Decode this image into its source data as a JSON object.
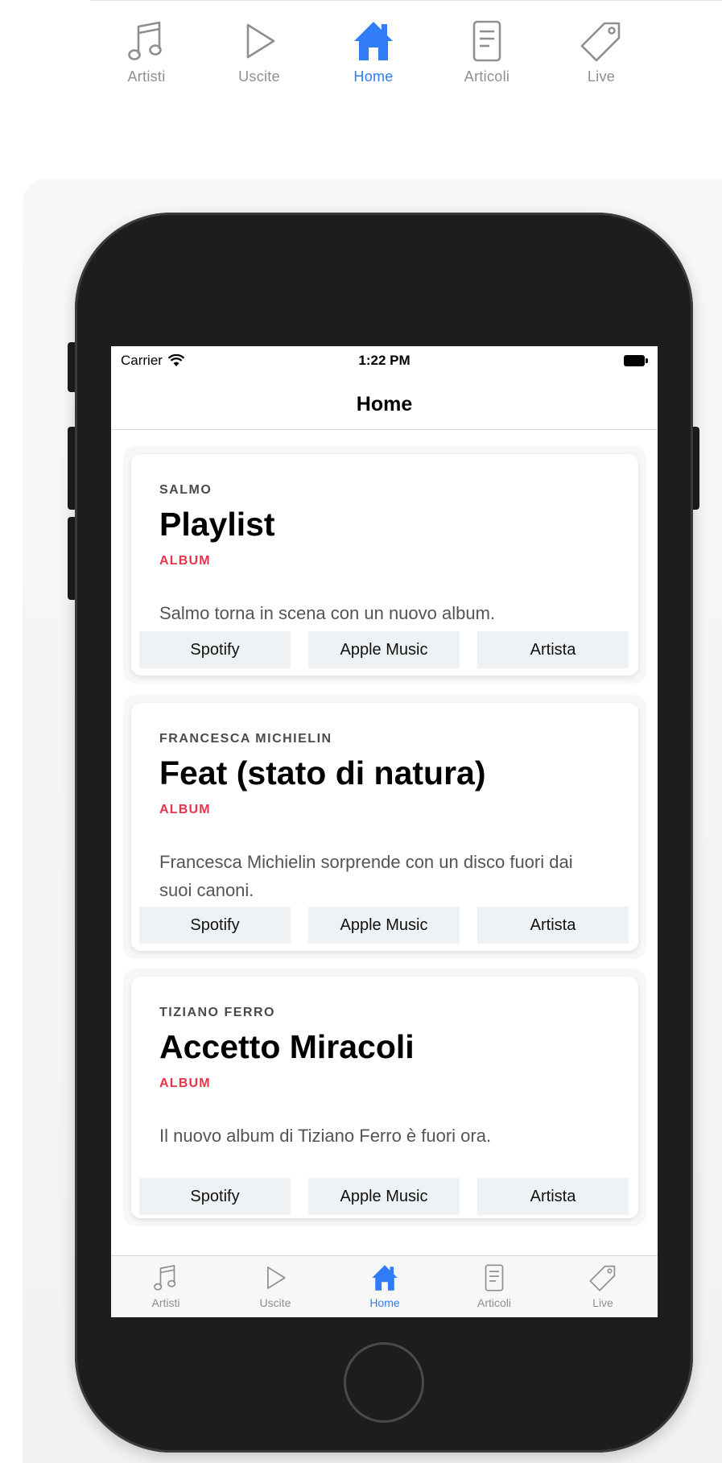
{
  "colors": {
    "accent": "#2f7cf6",
    "inactive": "#8e8e93",
    "type_label": "#e8334a"
  },
  "tabs": [
    {
      "label": "Artisti",
      "icon": "music-note-icon",
      "active": false
    },
    {
      "label": "Uscite",
      "icon": "play-icon",
      "active": false
    },
    {
      "label": "Home",
      "icon": "home-icon",
      "active": true
    },
    {
      "label": "Articoli",
      "icon": "document-icon",
      "active": false
    },
    {
      "label": "Live",
      "icon": "tag-icon",
      "active": false
    }
  ],
  "status_bar": {
    "carrier": "Carrier",
    "time": "1:22 PM"
  },
  "nav": {
    "title": "Home"
  },
  "cards": [
    {
      "artist": "SALMO",
      "title": "Playlist",
      "type": "ALBUM",
      "description": "Salmo torna in scena con un nuovo album.",
      "buttons": [
        "Spotify",
        "Apple Music",
        "Artista"
      ]
    },
    {
      "artist": "FRANCESCA MICHIELIN",
      "title": "Feat (stato di natura)",
      "type": "ALBUM",
      "description": "Francesca Michielin sorprende con un disco fuori dai suoi canoni.",
      "buttons": [
        "Spotify",
        "Apple Music",
        "Artista"
      ]
    },
    {
      "artist": "TIZIANO FERRO",
      "title": "Accetto Miracoli",
      "type": "ALBUM",
      "description": "Il nuovo album di Tiziano Ferro è fuori ora.",
      "buttons": [
        "Spotify",
        "Apple Music",
        "Artista"
      ]
    }
  ]
}
